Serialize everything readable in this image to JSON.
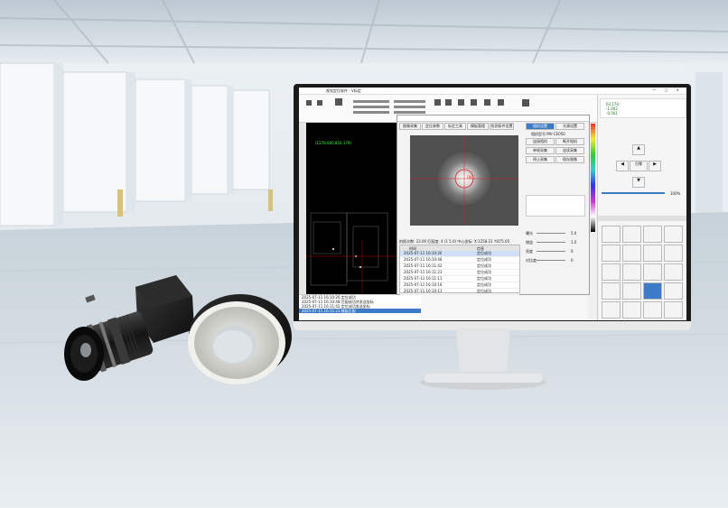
{
  "software": {
    "title": "视觉定位软件 - V标定",
    "canvas_label": "(1278.000,850.179)",
    "camera_dialog": {
      "tabs": [
        "图像采集",
        "定位参数",
        "标定工具",
        "模板管理",
        "检测条件设置"
      ],
      "right_tabs": [
        "相机设置",
        "光源设置"
      ],
      "info": "相机型号:MV-CE050",
      "right_buttons": [
        "连接相机",
        "断开相机",
        "单帧采集",
        "连续采集",
        "停止采集",
        "保存图像"
      ],
      "mark_label": "OK",
      "status": "拍照次数: 23.00    匹配度: 4 (1 5.0)    中心坐标: X:1258.21 Y:875.05",
      "columns": [
        "时间",
        "信息"
      ],
      "log_rows": [
        [
          "2025-07-11 16:10:26",
          "定位成功"
        ],
        [
          "2025-07-11 16:10:48",
          "定位成功"
        ],
        [
          "2025-07-11 16:11:42",
          "定位成功"
        ],
        [
          "2025-07-11 16:11:23",
          "定位成功"
        ],
        [
          "2025-07-11 16:11:13",
          "定位成功"
        ],
        [
          "2025-07-11 16:10:18",
          "定位成功"
        ],
        [
          "2025-07-11 16:10:13",
          "定位成功"
        ]
      ],
      "sliders": [
        "曝光",
        "增益",
        "亮度",
        "对比度"
      ],
      "values": [
        "5.0",
        "1.0",
        "0",
        "0"
      ]
    },
    "bottom_log": [
      "2025-07-11 16:10:26   定位成功",
      "2025-07-11 16:10:48   匹配成功并发送坐标",
      "2025-07-11 16:11:42   定位成功发送坐标",
      "2025-07-11 16:11:23   模板匹配"
    ],
    "coords": {
      "x": "63.170",
      "y": "-1.002",
      "z": "-0.561"
    },
    "right_panel": {
      "center_btn": "归零",
      "speed": "100%"
    }
  },
  "products": [
    "camera-with-lens",
    "ring-light"
  ]
}
